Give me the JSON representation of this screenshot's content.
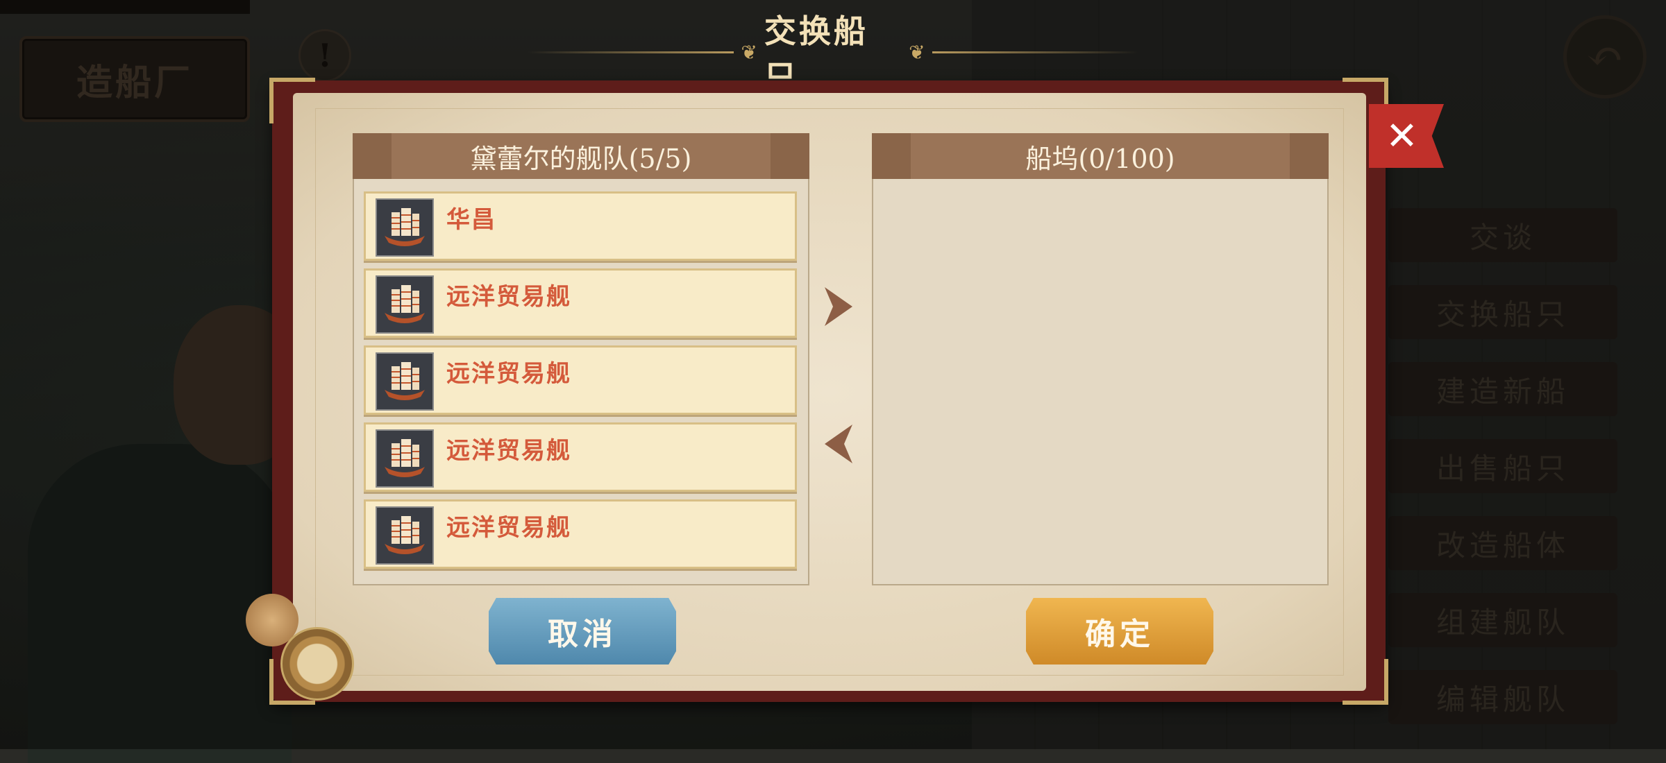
{
  "background": {
    "shop_sign": "造船厂",
    "side_menu": [
      "交谈",
      "交换船只",
      "建造新船",
      "出售船只",
      "改造船体",
      "组建舰队",
      "编辑舰队"
    ]
  },
  "dialog": {
    "title": "交换船只",
    "fleet_panel": {
      "header": "黛蕾尔的舰队(5/5)",
      "ships": [
        {
          "name": "华昌"
        },
        {
          "name": "远洋贸易舰"
        },
        {
          "name": "远洋贸易舰"
        },
        {
          "name": "远洋贸易舰"
        },
        {
          "name": "远洋贸易舰"
        }
      ]
    },
    "dock_panel": {
      "header": "船坞(0/100)"
    },
    "buttons": {
      "cancel": "取消",
      "confirm": "确定"
    },
    "close_label": "✕"
  },
  "colors": {
    "ship_name": "#d45a3b",
    "cancel_button": "#5f96b8",
    "confirm_button": "#e0a03c",
    "close_flag": "#c0302a",
    "book_cover": "#5e1d1a"
  },
  "icons": [
    "alert-icon",
    "back-arrow-icon",
    "close-icon",
    "ship-icon",
    "transfer-right-icon",
    "transfer-left-icon",
    "compass-icon"
  ]
}
